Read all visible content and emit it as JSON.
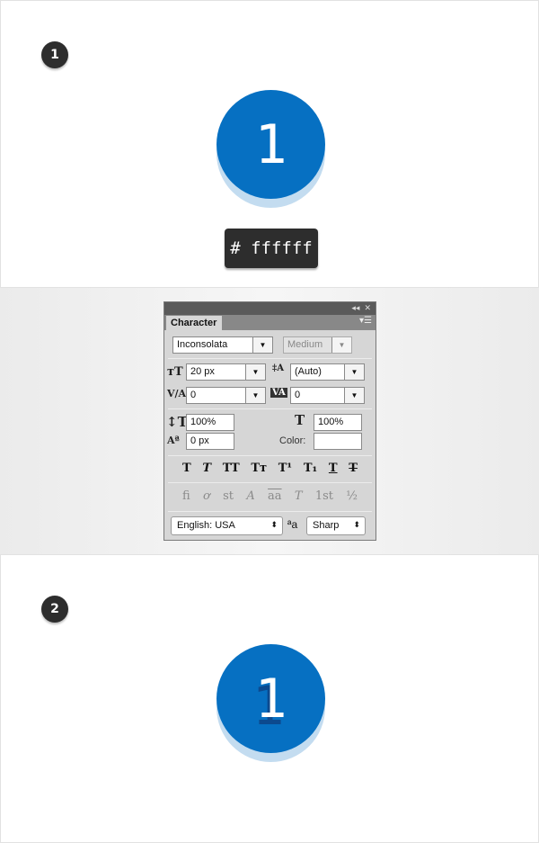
{
  "step1": {
    "number": "1",
    "circle_text": "1",
    "color_label": "# ffffff"
  },
  "step2": {
    "number": "2",
    "circle_text": "1"
  },
  "colors": {
    "circle": "#0670c2",
    "badge": "#2d2d2d",
    "shadow_text": "#0c4a8f"
  },
  "panel": {
    "titlebar_icons": [
      "collapse-icon",
      "close-icon"
    ],
    "tab": "Character",
    "font_family": "Inconsolata",
    "font_style": "Medium",
    "font_size": "20 px",
    "leading": "(Auto)",
    "kerning": "0",
    "tracking": "0",
    "vertical_scale": "100%",
    "horizontal_scale": "100%",
    "baseline_shift": "0 px",
    "color_label": "Color:",
    "style_buttons": [
      "T",
      "T",
      "TT",
      "Tт",
      "T¹",
      "T₁",
      "T",
      "T"
    ],
    "opentype_buttons": [
      "ﬁ",
      "ơ",
      "st",
      "A",
      "aa",
      "T",
      "1st",
      "½"
    ],
    "language": "English: USA",
    "antialias": "Sharp"
  }
}
